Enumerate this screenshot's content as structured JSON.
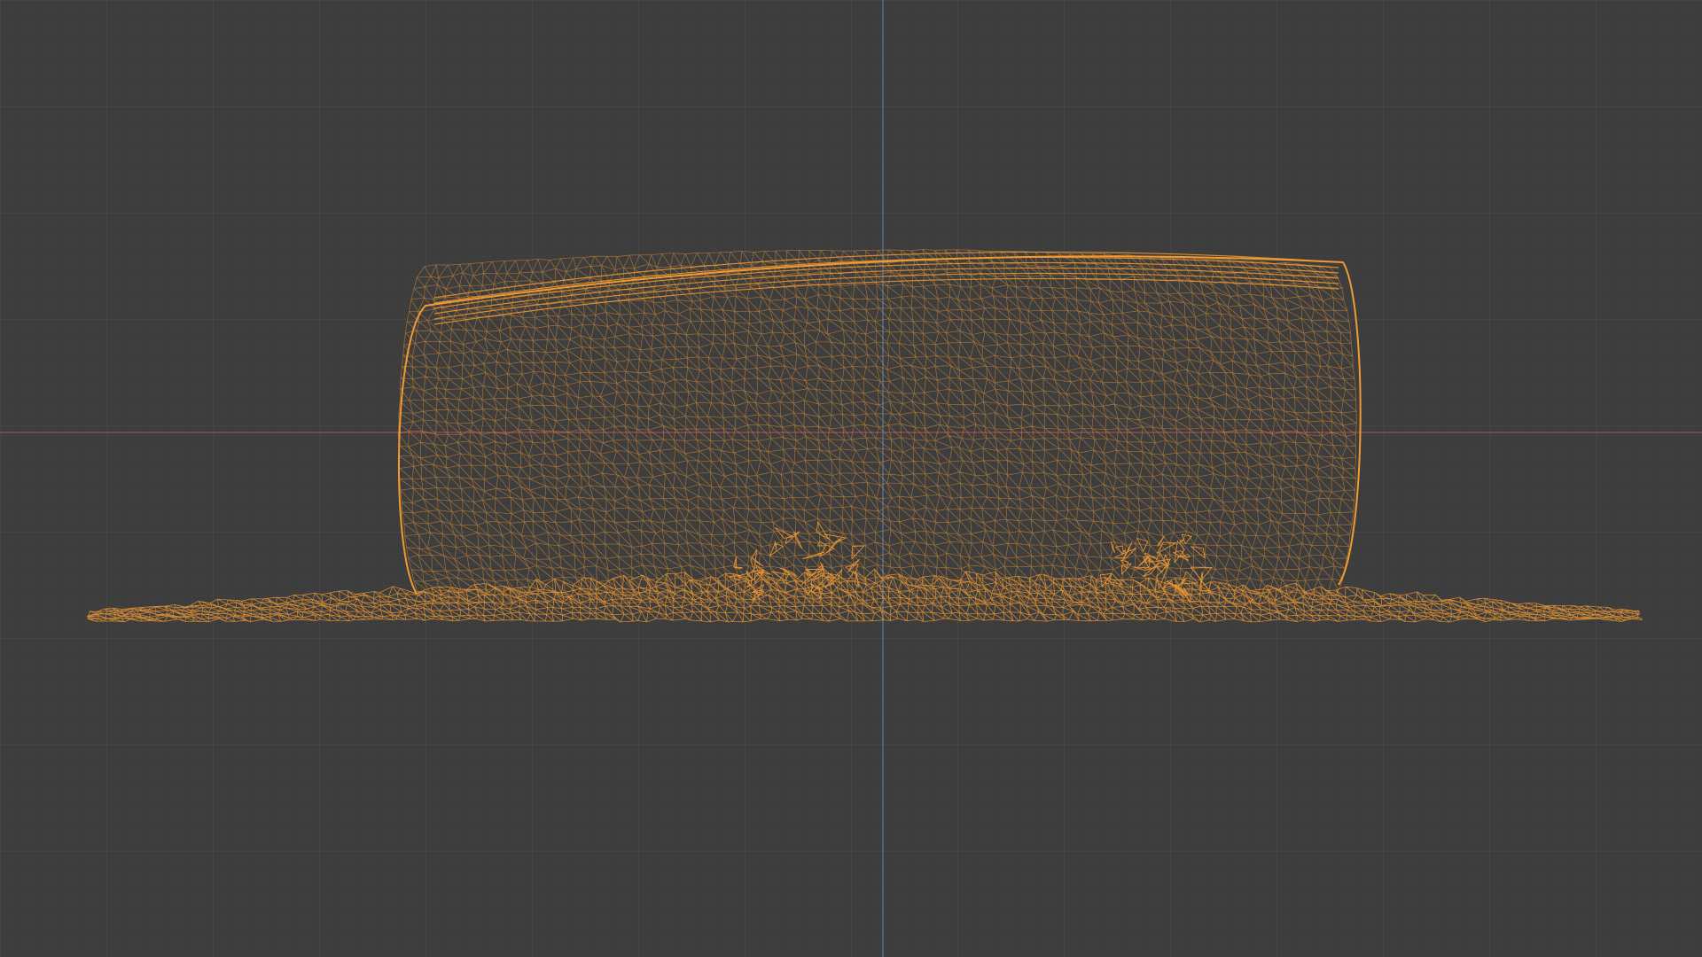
{
  "viewport": {
    "view_mode": "wireframe",
    "object": "tire-on-ground-scan-mesh",
    "colors": {
      "background": "#3d3d3d",
      "grid_minor": "#444444",
      "grid_major": "#4a4a4a",
      "axis_x": "#8a4b50",
      "axis_y": "#4f6e8f",
      "wire": "#f29a32"
    }
  }
}
